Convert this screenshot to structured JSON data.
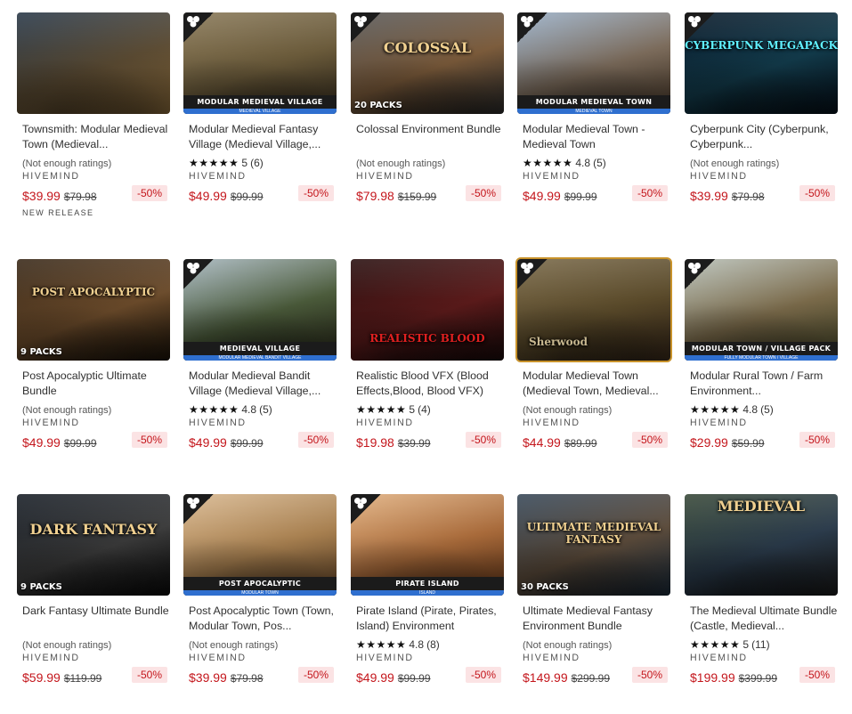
{
  "products": [
    {
      "title": "Townsmith: Modular Medieval Town (Medieval...",
      "rating_text": "(Not enough ratings)",
      "stars": "",
      "score": "",
      "count": "",
      "publisher": "HIVEMIND",
      "price": "$39.99",
      "old_price": "$79.98",
      "discount": "-50%",
      "new_release": "NEW RELEASE",
      "badge": false,
      "banner": "",
      "banner_sub": "",
      "overlay": "",
      "packs": "",
      "palette": [
        "#2b3a4a",
        "#5a4a32",
        "#8a6a3a"
      ]
    },
    {
      "title": "Modular Medieval Fantasy Village (Medieval Village,...",
      "rating_text": "",
      "stars": "★★★★★",
      "score": "5",
      "count": "(6)",
      "publisher": "HIVEMIND",
      "price": "$49.99",
      "old_price": "$99.99",
      "discount": "-50%",
      "new_release": "",
      "badge": true,
      "banner": "MODULAR MEDIEVAL VILLAGE",
      "banner_sub": "MEDIEVAL VILLAGE",
      "overlay": "",
      "packs": "",
      "palette": [
        "#8a7a5a",
        "#6a5a3a",
        "#3a3020"
      ]
    },
    {
      "title": "Colossal Environment Bundle",
      "rating_text": "(Not enough ratings)",
      "stars": "",
      "score": "",
      "count": "",
      "publisher": "HIVEMIND",
      "price": "$79.98",
      "old_price": "$159.99",
      "discount": "-50%",
      "new_release": "",
      "badge": true,
      "banner": "",
      "banner_sub": "",
      "overlay": "COLOSSAL",
      "packs": "20 PACKS",
      "palette": [
        "#5a5a5a",
        "#7a5a3a",
        "#2a2a2a"
      ]
    },
    {
      "title": "Modular Medieval Town - Medieval Town",
      "rating_text": "",
      "stars": "★★★★★",
      "score": "4.8",
      "count": "(5)",
      "publisher": "HIVEMIND",
      "price": "$49.99",
      "old_price": "$99.99",
      "discount": "-50%",
      "new_release": "",
      "badge": true,
      "banner": "MODULAR MEDIEVAL TOWN",
      "banner_sub": "MEDIEVAL TOWN",
      "overlay": "",
      "packs": "",
      "palette": [
        "#9ab0c8",
        "#7a6a5a",
        "#4a3a2a"
      ]
    },
    {
      "title": "Cyberpunk City (Cyberpunk, Cyberpunk...",
      "rating_text": "(Not enough ratings)",
      "stars": "",
      "score": "",
      "count": "",
      "publisher": "HIVEMIND",
      "price": "$39.99",
      "old_price": "$79.98",
      "discount": "-50%",
      "new_release": "",
      "badge": true,
      "banner": "",
      "banner_sub": "",
      "overlay": "CYBERPUNK MEGAPACK",
      "packs": "",
      "palette": [
        "#0a1a2a",
        "#123a4a",
        "#05101a"
      ]
    },
    {
      "title": "Post Apocalyptic Ultimate Bundle",
      "rating_text": "(Not enough ratings)",
      "stars": "",
      "score": "",
      "count": "",
      "publisher": "HIVEMIND",
      "price": "$49.99",
      "old_price": "$99.99",
      "discount": "-50%",
      "new_release": "",
      "badge": false,
      "banner": "",
      "banner_sub": "",
      "overlay": "POST APOCALYPTIC",
      "packs": "9 PACKS",
      "palette": [
        "#3a2a1a",
        "#6a4a2a",
        "#1a1208"
      ]
    },
    {
      "title": "Modular Medieval Bandit Village (Medieval Village,...",
      "rating_text": "",
      "stars": "★★★★★",
      "score": "4.8",
      "count": "(5)",
      "publisher": "HIVEMIND",
      "price": "$49.99",
      "old_price": "$99.99",
      "discount": "-50%",
      "new_release": "",
      "badge": true,
      "banner": "MEDIEVAL VILLAGE",
      "banner_sub": "MODULAR MEDIEVAL BANDIT VILLAGE",
      "overlay": "",
      "packs": "",
      "palette": [
        "#a8b8c0",
        "#4a5a3a",
        "#2a2a1a"
      ]
    },
    {
      "title": "Realistic Blood VFX (Blood Effects,Blood, Blood VFX)",
      "rating_text": "",
      "stars": "★★★★★",
      "score": "5",
      "count": "(4)",
      "publisher": "HIVEMIND",
      "price": "$19.98",
      "old_price": "$39.99",
      "discount": "-50%",
      "new_release": "",
      "badge": false,
      "banner": "",
      "banner_sub": "",
      "overlay": "REALISTIC BLOOD",
      "packs": "",
      "palette": [
        "#2a1010",
        "#5a1a1a",
        "#1a0a0a"
      ]
    },
    {
      "title": "Modular Medieval Town (Medieval Town, Medieval...",
      "rating_text": "(Not enough ratings)",
      "stars": "",
      "score": "",
      "count": "",
      "publisher": "HIVEMIND",
      "price": "$44.99",
      "old_price": "$89.99",
      "discount": "-50%",
      "new_release": "",
      "badge": true,
      "banner": "",
      "banner_sub": "",
      "overlay": "Sherwood",
      "packs": "",
      "palette": [
        "#7a6a4a",
        "#5a4a2a",
        "#3a2a1a"
      ]
    },
    {
      "title": "Modular Rural Town / Farm Environment...",
      "rating_text": "",
      "stars": "★★★★★",
      "score": "4.8",
      "count": "(5)",
      "publisher": "HIVEMIND",
      "price": "$29.99",
      "old_price": "$59.99",
      "discount": "-50%",
      "new_release": "",
      "badge": true,
      "banner": "MODULAR TOWN / VILLAGE PACK",
      "banner_sub": "FULLY MODULAR TOWN / VILLAGE",
      "overlay": "",
      "packs": "",
      "palette": [
        "#b8c0b8",
        "#7a6a4a",
        "#4a4a2a"
      ]
    },
    {
      "title": "Dark Fantasy Ultimate Bundle",
      "rating_text": "(Not enough ratings)",
      "stars": "",
      "score": "",
      "count": "",
      "publisher": "HIVEMIND",
      "price": "$59.99",
      "old_price": "$119.99",
      "discount": "-50%",
      "new_release": "",
      "badge": false,
      "banner": "",
      "banner_sub": "",
      "overlay": "DARK FANTASY",
      "packs": "9 PACKS",
      "palette": [
        "#1a2028",
        "#3a3a3a",
        "#0a0a0a"
      ]
    },
    {
      "title": "Post Apocalyptic Town (Town, Modular Town, Pos...",
      "rating_text": "(Not enough ratings)",
      "stars": "",
      "score": "",
      "count": "",
      "publisher": "HIVEMIND",
      "price": "$39.99",
      "old_price": "$79.98",
      "discount": "-50%",
      "new_release": "",
      "badge": true,
      "banner": "POST APOCALYPTIC",
      "banner_sub": "MODULAR TOWN",
      "overlay": "",
      "packs": "",
      "palette": [
        "#d8b890",
        "#a88050",
        "#6a4a2a"
      ]
    },
    {
      "title": "Pirate Island (Pirate, Pirates, Island) Environment",
      "rating_text": "",
      "stars": "★★★★★",
      "score": "4.8",
      "count": "(8)",
      "publisher": "HIVEMIND",
      "price": "$49.99",
      "old_price": "$99.99",
      "discount": "-50%",
      "new_release": "",
      "badge": true,
      "banner": "PIRATE ISLAND",
      "banner_sub": "ISLAND",
      "overlay": "",
      "packs": "",
      "palette": [
        "#e0b080",
        "#a86a3a",
        "#6a3a1a"
      ]
    },
    {
      "title": "Ultimate Medieval Fantasy Environment Bundle",
      "rating_text": "(Not enough ratings)",
      "stars": "",
      "score": "",
      "count": "",
      "publisher": "HIVEMIND",
      "price": "$149.99",
      "old_price": "$299.99",
      "discount": "-50%",
      "new_release": "",
      "badge": false,
      "banner": "",
      "banner_sub": "",
      "overlay": "ULTIMATE MEDIEVAL FANTASY",
      "packs": "30 PACKS",
      "palette": [
        "#3a4a5a",
        "#5a4a3a",
        "#1a2a3a"
      ]
    },
    {
      "title": "The Medieval Ultimate Bundle (Castle, Medieval...",
      "rating_text": "",
      "stars": "★★★★★",
      "score": "5",
      "count": "(11)",
      "publisher": "HIVEMIND",
      "price": "$199.99",
      "old_price": "$399.99",
      "discount": "-50%",
      "new_release": "",
      "badge": false,
      "banner": "",
      "banner_sub": "",
      "overlay": "MEDIEVAL",
      "packs": "",
      "palette": [
        "#3a4a3a",
        "#2a3a4a",
        "#1a1a1a"
      ]
    }
  ]
}
